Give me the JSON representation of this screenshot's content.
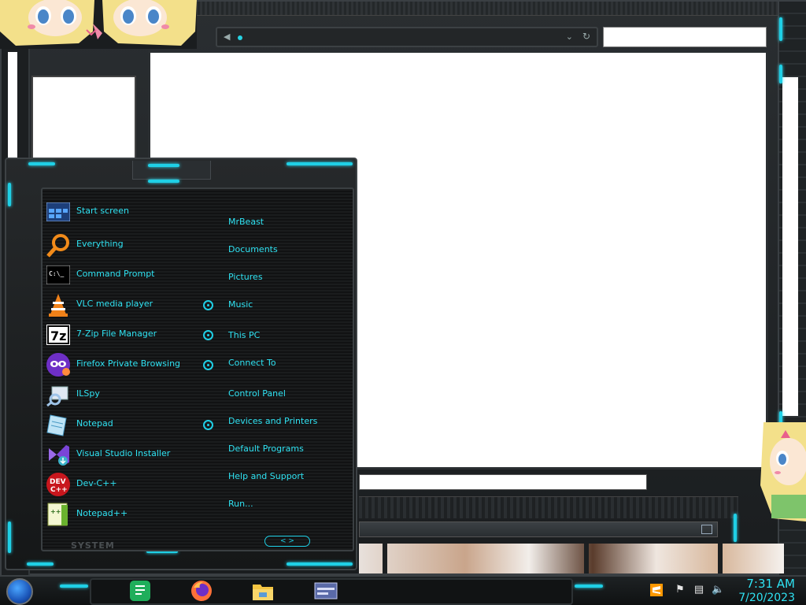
{
  "start_menu": {
    "programs": [
      {
        "label": "Start screen",
        "icon": "start-screen-icon"
      },
      {
        "label": "Everything",
        "icon": "search-magnifier-icon"
      },
      {
        "label": "Command Prompt",
        "icon": "terminal-icon"
      },
      {
        "label": "VLC media player",
        "icon": "vlc-cone-icon",
        "has_submenu": true
      },
      {
        "label": "7-Zip File Manager",
        "icon": "7zip-icon",
        "has_submenu": true
      },
      {
        "label": "Firefox Private Browsing",
        "icon": "firefox-private-icon",
        "has_submenu": true
      },
      {
        "label": "ILSpy",
        "icon": "ilspy-icon"
      },
      {
        "label": "Notepad",
        "icon": "notepad-icon",
        "has_submenu": true
      },
      {
        "label": "Visual Studio Installer",
        "icon": "vs-installer-icon"
      },
      {
        "label": "Dev-C++",
        "icon": "devcpp-icon"
      },
      {
        "label": "Notepad++",
        "icon": "notepadpp-icon"
      }
    ],
    "places": [
      {
        "label": "MrBeast"
      },
      {
        "label": "Documents"
      },
      {
        "label": "Pictures"
      },
      {
        "label": "Music"
      },
      {
        "label": "This PC"
      },
      {
        "label": "Connect To"
      },
      {
        "label": "Control Panel"
      },
      {
        "label": "Devices and Printers"
      },
      {
        "label": "Default Programs"
      },
      {
        "label": "Help and Support"
      },
      {
        "label": "Run..."
      }
    ],
    "footer_label": "SYSTEM",
    "scroll_arrows": "< >"
  },
  "taskbar": {
    "pinned": [
      {
        "icon": "notes-app-icon"
      },
      {
        "icon": "firefox-icon"
      },
      {
        "icon": "file-explorer-icon"
      },
      {
        "icon": "window-app-icon"
      }
    ],
    "tray": [
      {
        "icon": "sublime-text-icon"
      },
      {
        "icon": "flag-icon"
      },
      {
        "icon": "network-icon"
      },
      {
        "icon": "volume-icon"
      }
    ],
    "time": "7:31 AM",
    "date": "7/20/2023"
  },
  "colors": {
    "accent": "#1fd0e6",
    "text_accent": "#2fe2f2",
    "frame": "#2a2e31"
  }
}
